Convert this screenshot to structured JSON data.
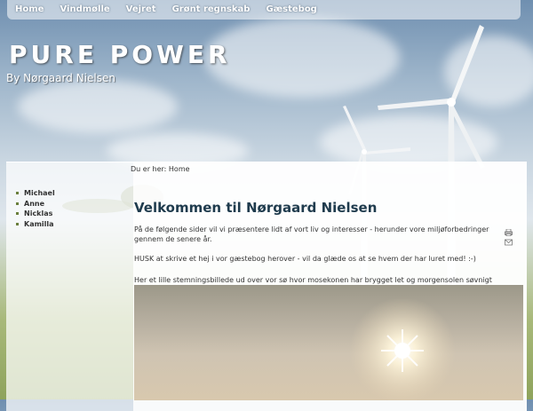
{
  "nav": {
    "items": [
      "Home",
      "Vindmølle",
      "Vejret",
      "Grønt regnskab",
      "Gæstebog"
    ]
  },
  "header": {
    "title": "PURE POWER",
    "subtitle": "By Nørgaard Nielsen"
  },
  "breadcrumb": {
    "text": "Du er her: Home"
  },
  "sidebar": {
    "items": [
      "Michael",
      "Anne",
      "Nicklas",
      "Kamilla"
    ]
  },
  "article": {
    "title": "Velkommen til Nørgaard Nielsen",
    "para1": "På de følgende sider vil vi præsentere lidt af vort liv og interesser - herunder vore miljøforbedringer gennem de senere år.",
    "para2": "HUSK at skrive et hej i vor gæstebog herover - vil da glæde os at se hvem der har luret med! :-)",
    "para3": "Her et lille stemningsbillede ud over vor sø hvor mosekonen har brygget let og morgensolen søvnigt stiger op:",
    "icons": [
      "print-icon",
      "email-icon"
    ]
  },
  "colors": {
    "title": "#1f3b4d",
    "nav_text": "#ffffff"
  }
}
